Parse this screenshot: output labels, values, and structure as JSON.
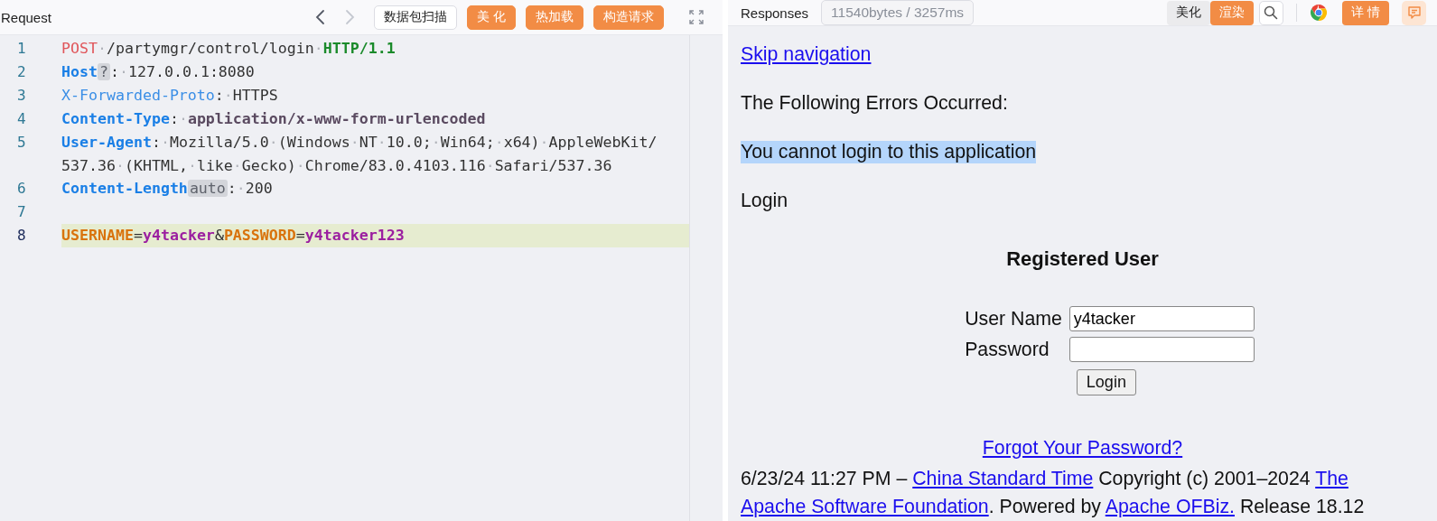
{
  "request": {
    "title": "Request",
    "nav": [
      {
        "kind": "prev",
        "disabled": false
      },
      {
        "kind": "next",
        "disabled": true
      }
    ],
    "buttons": [
      {
        "label": "数据包扫描",
        "kind": "outline"
      },
      {
        "label": "美 化",
        "kind": "primary"
      },
      {
        "label": "热加载",
        "kind": "primary"
      },
      {
        "label": "构造请求",
        "kind": "primary"
      }
    ],
    "lines": [
      {
        "number": "1",
        "highlighted": false,
        "tokens": [
          {
            "kind": "method",
            "text": "POST"
          },
          {
            "kind": "value",
            "text": "·/partymgr/control/login·"
          },
          {
            "kind": "version",
            "text": "HTTP/1.1"
          }
        ]
      },
      {
        "number": "2",
        "highlighted": false,
        "tokens": [
          {
            "kind": "key",
            "text": "Host"
          },
          {
            "kind": "badge",
            "text": "?"
          },
          {
            "kind": "value",
            "text": ":·127.0.0.1:8080"
          }
        ]
      },
      {
        "number": "3",
        "highlighted": false,
        "tokens": [
          {
            "kind": "key-plain",
            "text": "X-Forwarded-Proto"
          },
          {
            "kind": "value",
            "text": ":·HTTPS"
          }
        ]
      },
      {
        "number": "4",
        "highlighted": false,
        "tokens": [
          {
            "kind": "key",
            "text": "Content-Type"
          },
          {
            "kind": "value",
            "text": ":·"
          },
          {
            "kind": "value-strong",
            "text": "application/x-www-form-urlencoded"
          }
        ]
      },
      {
        "number": "5",
        "highlighted": false,
        "tokens": [
          {
            "kind": "key",
            "text": "User-Agent"
          },
          {
            "kind": "value",
            "text": ":·Mozilla/5.0·(Windows·NT·10.0;·Win64;·x64)·AppleWebKit/"
          },
          {
            "kind": "break"
          },
          {
            "kind": "value",
            "text": "537.36·(KHTML,·like·Gecko)·Chrome/83.0.4103.116·Safari/537.36"
          }
        ]
      },
      {
        "number": "6",
        "highlighted": false,
        "tokens": [
          {
            "kind": "key",
            "text": "Content-Length"
          },
          {
            "kind": "badge",
            "text": "auto"
          },
          {
            "kind": "value",
            "text": ":·200"
          }
        ]
      },
      {
        "number": "7",
        "highlighted": false
      },
      {
        "number": "8",
        "highlighted": true,
        "tokens": [
          {
            "kind": "param-key",
            "text": "USERNAME"
          },
          {
            "kind": "value",
            "text": "="
          },
          {
            "kind": "param-value",
            "text": "y4tacker"
          },
          {
            "kind": "value",
            "text": "&"
          },
          {
            "kind": "param-key",
            "text": "PASSWORD"
          },
          {
            "kind": "value",
            "text": "="
          },
          {
            "kind": "param-value",
            "text": "y4tacker123"
          }
        ]
      }
    ]
  },
  "response": {
    "title": "Responses",
    "stats": "11540bytes / 3257ms",
    "view_modes": [
      {
        "label": "美化",
        "selected": false
      },
      {
        "label": "渲染",
        "selected": true
      }
    ],
    "details_button": "详 情",
    "page": {
      "skip_link": "Skip navigation",
      "error_heading": "The Following Errors Occurred:",
      "error_message": {
        "text": "You cannot login to this application",
        "selected": true
      },
      "section_title": "Login",
      "form_title": "Registered User",
      "fields": [
        {
          "label": "User Name",
          "value": "y4tacker"
        },
        {
          "label": "Password"
        }
      ],
      "submit": "Login",
      "forgot_link": "Forgot Your Password?",
      "footer": [
        {
          "kind": "text",
          "text": "6/23/24 11:27 PM – "
        },
        {
          "kind": "link",
          "text": "China Standard Time"
        },
        {
          "kind": "text",
          "text": " Copyright (c) 2001–2024 "
        },
        {
          "kind": "link",
          "text": "The"
        },
        {
          "kind": "link",
          "text": "Apache Software Foundation"
        },
        {
          "kind": "text",
          "text": ". Powered by "
        },
        {
          "kind": "link",
          "text": "Apache OFBiz."
        },
        {
          "kind": "text",
          "text": " Release 18.12"
        }
      ]
    }
  }
}
